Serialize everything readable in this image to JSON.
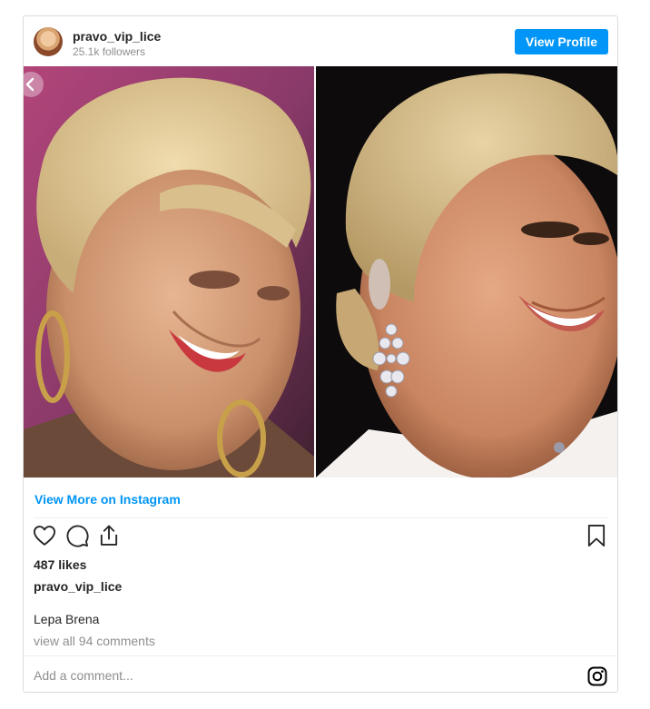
{
  "post": {
    "username": "pravo_vip_lice",
    "followers": "25.1k followers",
    "view_profile_label": "View Profile",
    "view_more_label": "View More on Instagram",
    "likes": "487 likes",
    "caption_username": "pravo_vip_lice",
    "caption_text": "Lepa Brena",
    "comments_link": "view all 94 comments",
    "comment_placeholder": "Add a comment..."
  },
  "colors": {
    "accent": "#0095f6",
    "muted": "#8e8e8e",
    "text": "#262626",
    "border": "#dbdbdb"
  },
  "icons": [
    "chevron-left-icon",
    "heart-icon",
    "comment-icon",
    "share-icon",
    "bookmark-icon",
    "instagram-icon"
  ]
}
